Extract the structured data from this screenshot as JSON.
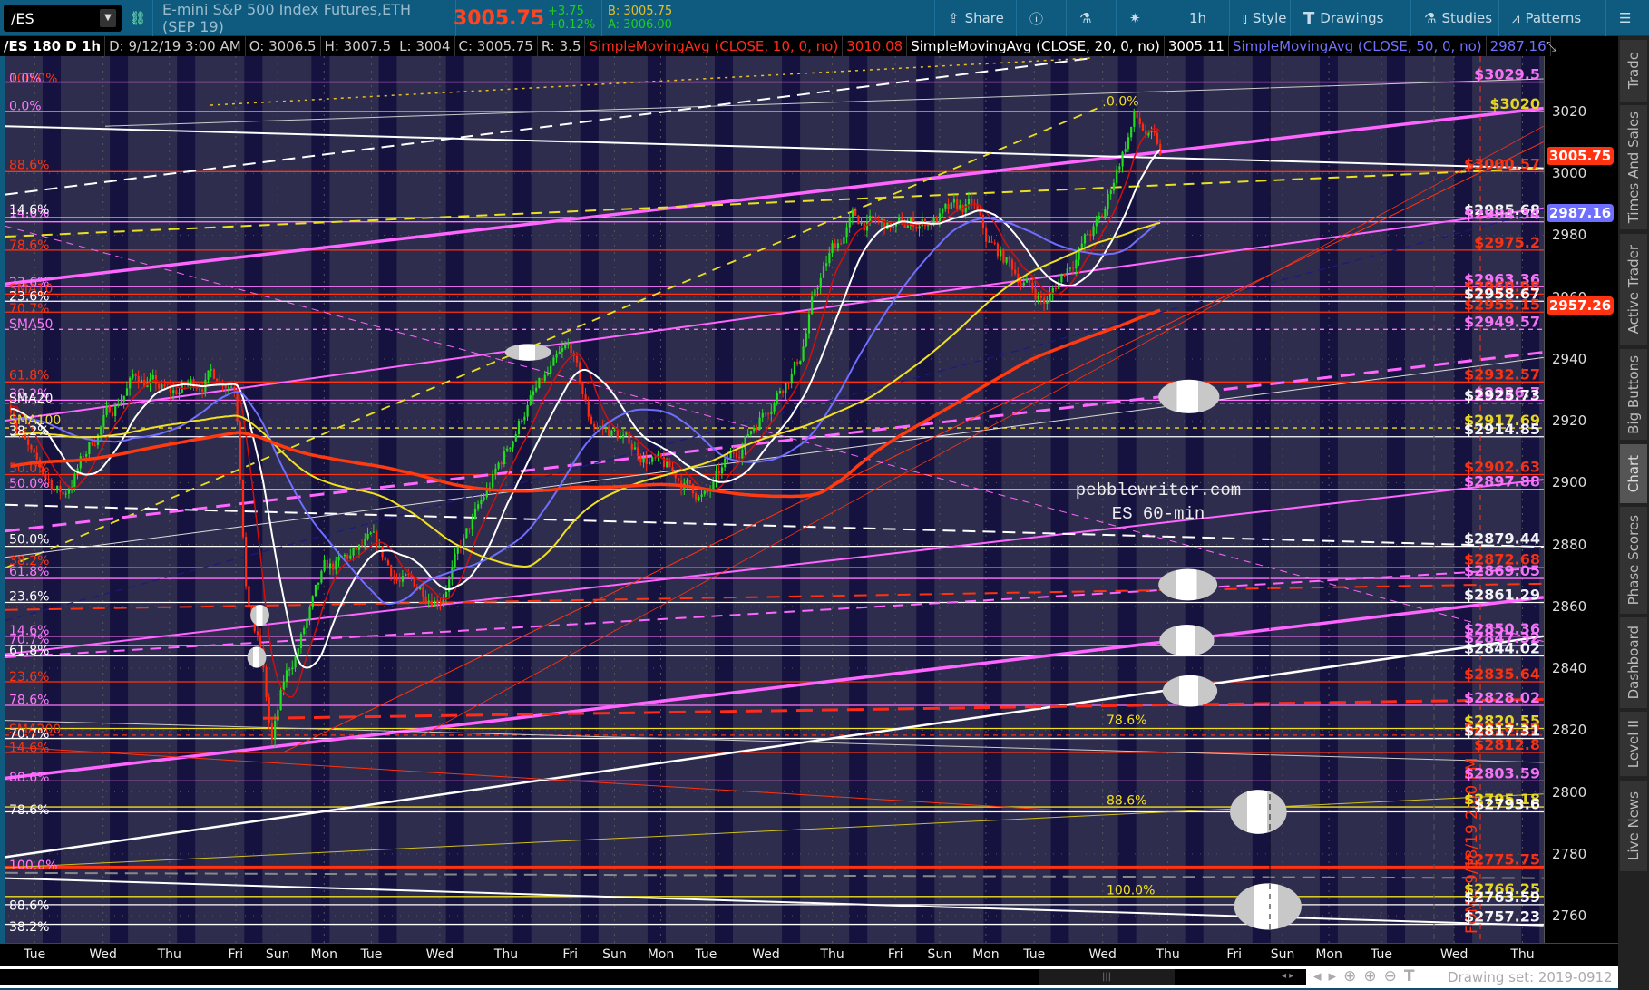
{
  "toolbar": {
    "symbol": "/ES",
    "description": "E-mini S&P 500 Index Futures,ETH (SEP 19)",
    "last": "3005.75",
    "change": "+3.75",
    "change_pct": "+0.12%",
    "bid": "B: 3005.75",
    "ask": "A: 3006.00",
    "share_label": "Share",
    "interval_label": "1h",
    "style_label": "Style",
    "drawings_label": "Drawings",
    "studies_label": "Studies",
    "patterns_label": "Patterns",
    "colors": {
      "bg": "#0f5b80",
      "last": "#ff4422",
      "up": "#22cc22",
      "bid": "#e8c020"
    }
  },
  "infobar": {
    "title": "/ES 180 D 1h",
    "date": "D: 9/12/19 3:00 AM",
    "open": "O: 3006.5",
    "high": "H: 3007.5",
    "low": "L: 3004",
    "close": "C: 3005.75",
    "range": "R: 3.5",
    "studies": [
      {
        "label": "SimpleMovingAvg (CLOSE, 10, 0, no)",
        "value": "3010.08",
        "color": "#ff2a1a"
      },
      {
        "label": "SimpleMovingAvg (CLOSE, 20, 0, no)",
        "value": "3005.11",
        "color": "#ffffff"
      },
      {
        "label": "SimpleMovingAvg (CLOSE, 50, 0, no)",
        "value": "2987.16",
        "color": "#6e6eff"
      }
    ]
  },
  "watermark": {
    "line1": "pebblewriter.com",
    "line2": "ES 60-min"
  },
  "fomc_label": "FOMC 9/18/19 2:00 PM",
  "chart_data": {
    "type": "candlestick",
    "price_axis": {
      "min": 2755,
      "max": 3035,
      "ticks": [
        3020,
        3000,
        2980,
        2960,
        2940,
        2920,
        2900,
        2880,
        2860,
        2840,
        2820,
        2800,
        2780,
        2760
      ]
    },
    "time_labels": [
      "Tue",
      "Wed",
      "Thu",
      "Fri",
      "Sun",
      "Mon",
      "Tue",
      "Wed",
      "Thu",
      "Fri",
      "Sun",
      "Mon",
      "Tue",
      "Wed",
      "Thu",
      "Fri",
      "Sun",
      "Mon",
      "Tue",
      "Wed",
      "Thu",
      "Fri",
      "Sun",
      "Mon",
      "Tue",
      "Wed",
      "Thu"
    ],
    "price_path": [
      [
        -0.35,
        2925
      ],
      [
        0,
        2905
      ],
      [
        0.42,
        2896
      ],
      [
        1,
        2920
      ],
      [
        1.5,
        2935
      ],
      [
        2,
        2928
      ],
      [
        2.62,
        2935
      ],
      [
        3,
        2933
      ],
      [
        3.27,
        2862
      ],
      [
        3.6,
        2845
      ],
      [
        3.85,
        2815
      ],
      [
        4.14,
        2835
      ],
      [
        5,
        2870
      ],
      [
        6,
        2880
      ],
      [
        6.42,
        2868
      ],
      [
        7,
        2864
      ],
      [
        7.35,
        2880
      ],
      [
        8,
        2910
      ],
      [
        8.31,
        2925
      ],
      [
        9,
        2943
      ],
      [
        9.43,
        2920
      ],
      [
        10,
        2916
      ],
      [
        11,
        2905
      ],
      [
        12,
        2895
      ],
      [
        12.5,
        2910
      ],
      [
        13,
        2925
      ],
      [
        13.5,
        2940
      ],
      [
        13.75,
        2962
      ],
      [
        14,
        2975
      ],
      [
        14.32,
        2985
      ],
      [
        15,
        2982
      ],
      [
        16,
        2986
      ],
      [
        16.73,
        2989
      ],
      [
        17,
        2978
      ],
      [
        17.5,
        2970
      ],
      [
        18,
        2962
      ],
      [
        18.18,
        2958
      ],
      [
        18.42,
        2968
      ],
      [
        18.72,
        2978
      ],
      [
        19,
        2985
      ],
      [
        19.19,
        3000
      ],
      [
        19.48,
        3018
      ],
      [
        19.68,
        3012
      ],
      [
        19.92,
        3005.75
      ]
    ],
    "price_tags": [
      {
        "value": "3005.75",
        "price": 3005.75,
        "color": "#ff3311"
      },
      {
        "value": "2987.16",
        "price": 2987.16,
        "color": "#6e6eff"
      },
      {
        "value": "2957.26",
        "price": 2957.26,
        "color": "#ff3311"
      }
    ],
    "levels": [
      {
        "label": "$3029.5",
        "price": 3029.5,
        "color": "#ff77ff"
      },
      {
        "label": "$3020",
        "price": 3020,
        "color": "#f0e020"
      },
      {
        "label": "$3000.57",
        "price": 3000.57,
        "color": "#ff3311"
      },
      {
        "label": "$2985.68",
        "price": 2985.68,
        "color": "#ffffff"
      },
      {
        "label": "$2984.34",
        "price": 2984.34,
        "color": "#ff77ff"
      },
      {
        "label": "$2975.2",
        "price": 2975.2,
        "color": "#ff3311"
      },
      {
        "label": "$2963.36",
        "price": 2963.36,
        "color": "#ff77ff"
      },
      {
        "label": "$2960.98",
        "price": 2960.98,
        "color": "#ff3311"
      },
      {
        "label": "$2958.67",
        "price": 2958.67,
        "color": "#ffffff"
      },
      {
        "label": "$2955.15",
        "price": 2955.15,
        "color": "#ff3311"
      },
      {
        "label": "$2949.57",
        "price": 2949.57,
        "color": "#ff77ff"
      },
      {
        "label": "$2932.57",
        "price": 2932.57,
        "color": "#ff3311"
      },
      {
        "label": "$2926.7",
        "price": 2926.7,
        "color": "#ff77ff"
      },
      {
        "label": "$2925.73",
        "price": 2925.73,
        "color": "#ffffff"
      },
      {
        "label": "$2917.69",
        "price": 2917.69,
        "color": "#f0e020"
      },
      {
        "label": "$2914.85",
        "price": 2914.85,
        "color": "#ffffff"
      },
      {
        "label": "$2902.63",
        "price": 2902.63,
        "color": "#ff3311"
      },
      {
        "label": "$2897.88",
        "price": 2897.88,
        "color": "#ff77ff"
      },
      {
        "label": "$2879.44",
        "price": 2879.44,
        "color": "#ffffff"
      },
      {
        "label": "$2872.68",
        "price": 2872.68,
        "color": "#ff3311"
      },
      {
        "label": "$2869.05",
        "price": 2869.05,
        "color": "#ff77ff"
      },
      {
        "label": "$2861.29",
        "price": 2861.29,
        "color": "#ffffff"
      },
      {
        "label": "$2850.36",
        "price": 2850.36,
        "color": "#ff77ff"
      },
      {
        "label": "$2847.32",
        "price": 2847.32,
        "color": "#ff77ff"
      },
      {
        "label": "$2844.02",
        "price": 2844.02,
        "color": "#ffffff"
      },
      {
        "label": "$2835.64",
        "price": 2835.64,
        "color": "#ff3311"
      },
      {
        "label": "$2828.02",
        "price": 2828.02,
        "color": "#ff77ff"
      },
      {
        "label": "$2820.55",
        "price": 2820.55,
        "color": "#f0e020"
      },
      {
        "label": "$2818.39",
        "price": 2818.39,
        "color": "#ff3311"
      },
      {
        "label": "$2817.31",
        "price": 2817.31,
        "color": "#ffffff"
      },
      {
        "label": "$2812.8",
        "price": 2812.8,
        "color": "#ff3311"
      },
      {
        "label": "$2803.59",
        "price": 2803.59,
        "color": "#ff77ff"
      },
      {
        "label": "$2795.18",
        "price": 2795.18,
        "color": "#f0e020"
      },
      {
        "label": "$2793.6",
        "price": 2793.6,
        "color": "#ffffff"
      },
      {
        "label": "$2775.75",
        "price": 2775.75,
        "color": "#ff3311"
      },
      {
        "label": "$2766.25",
        "price": 2766.25,
        "color": "#f0e020"
      },
      {
        "label": "$2763.59",
        "price": 2763.59,
        "color": "#ffffff"
      },
      {
        "label": "$2757.23",
        "price": 2757.23,
        "color": "#ffffff"
      }
    ],
    "fib_labels_left": [
      {
        "label": "100.0%",
        "price": 3030,
        "color": "#ff3311"
      },
      {
        "label": "0.0%",
        "price": 3030,
        "color": "#ff77ff"
      },
      {
        "label": "0.0%",
        "price": 3021,
        "color": "#ff77ff"
      },
      {
        "label": "88.6%",
        "price": 3002,
        "color": "#ff3311"
      },
      {
        "label": "14.6%",
        "price": 2986.5,
        "color": "#ff77ff"
      },
      {
        "label": "14.6%",
        "price": 2987.5,
        "color": "#ffffff"
      },
      {
        "label": "78.6%",
        "price": 2976,
        "color": "#ff3311"
      },
      {
        "label": "23.6%",
        "price": 2964,
        "color": "#ff77ff"
      },
      {
        "label": "SMA10",
        "price": 2962,
        "color": "#ff3311"
      },
      {
        "label": "23.6%",
        "price": 2959.5,
        "color": "#ffffff"
      },
      {
        "label": "70.7%",
        "price": 2955.5,
        "color": "#ff3311"
      },
      {
        "label": "SMA50",
        "price": 2950.5,
        "color": "#ff77ff"
      },
      {
        "label": "61.8%",
        "price": 2934,
        "color": "#ff3311"
      },
      {
        "label": "38.2%",
        "price": 2928,
        "color": "#ff77ff"
      },
      {
        "label": "SMA20",
        "price": 2926.5,
        "color": "#ffffff"
      },
      {
        "label": "SMA100",
        "price": 2919.5,
        "color": "#f0e020"
      },
      {
        "label": "38.2%",
        "price": 2916,
        "color": "#ffffff"
      },
      {
        "label": "50.0%",
        "price": 2904,
        "color": "#ff3311"
      },
      {
        "label": "50.0%",
        "price": 2899,
        "color": "#ff77ff"
      },
      {
        "label": "50.0%",
        "price": 2881,
        "color": "#ffffff"
      },
      {
        "label": "38.2%",
        "price": 2874,
        "color": "#ff3311"
      },
      {
        "label": "61.8%",
        "price": 2870.5,
        "color": "#ff77ff"
      },
      {
        "label": "23.6%",
        "price": 2862.5,
        "color": "#ffffff"
      },
      {
        "label": "14.6%",
        "price": 2851.5,
        "color": "#ff77ff"
      },
      {
        "label": "70.7%",
        "price": 2848.5,
        "color": "#ff77ff"
      },
      {
        "label": "61.8%",
        "price": 2845,
        "color": "#ffffff"
      },
      {
        "label": "23.6%",
        "price": 2836.5,
        "color": "#ff3311"
      },
      {
        "label": "78.6%",
        "price": 2829,
        "color": "#ff77ff"
      },
      {
        "label": "SMA200",
        "price": 2819.5,
        "color": "#ff3311"
      },
      {
        "label": "70.7%",
        "price": 2818,
        "color": "#ffffff"
      },
      {
        "label": "14.6%",
        "price": 2813.5,
        "color": "#ff3311"
      },
      {
        "label": "88.6%",
        "price": 2804,
        "color": "#ff77ff"
      },
      {
        "label": "78.6%",
        "price": 2793.5,
        "color": "#ffffff"
      },
      {
        "label": "100.0%",
        "price": 2775.5,
        "color": "#ff3311"
      },
      {
        "label": "100.0%",
        "price": 2775.5,
        "color": "#ff77ff"
      },
      {
        "label": "88.6%",
        "price": 2762.5,
        "color": "#ffffff"
      },
      {
        "label": "38.2%",
        "price": 2755.7,
        "color": "#ffffff"
      }
    ],
    "fib_labels_mid": [
      {
        "label": "0.0%",
        "price": 3021
      },
      {
        "label": "78.6%",
        "price": 2821
      },
      {
        "label": "88.6%",
        "price": 2795
      },
      {
        "label": "100.0%",
        "price": 2766
      }
    ],
    "sma_series": [
      {
        "name": "SMA10",
        "period": 10,
        "color": "#d01010"
      },
      {
        "name": "SMA20",
        "period": 20,
        "color": "#ffffff"
      },
      {
        "name": "SMA50",
        "period": 50,
        "color": "#6e6eff"
      },
      {
        "name": "SMA100",
        "period": 100,
        "color": "#f0e020"
      },
      {
        "name": "SMA200",
        "period": 200,
        "color": "#ff3a10"
      }
    ]
  },
  "sidebar": {
    "tabs": [
      "Trade",
      "Times And Sales",
      "Active Trader",
      "Big Buttons",
      "Chart",
      "Phase Scores",
      "Dashboard",
      "Level II",
      "Live News"
    ],
    "active": "Chart"
  },
  "bottombar": {
    "drawing_set": "Drawing set: 2019-0912"
  }
}
